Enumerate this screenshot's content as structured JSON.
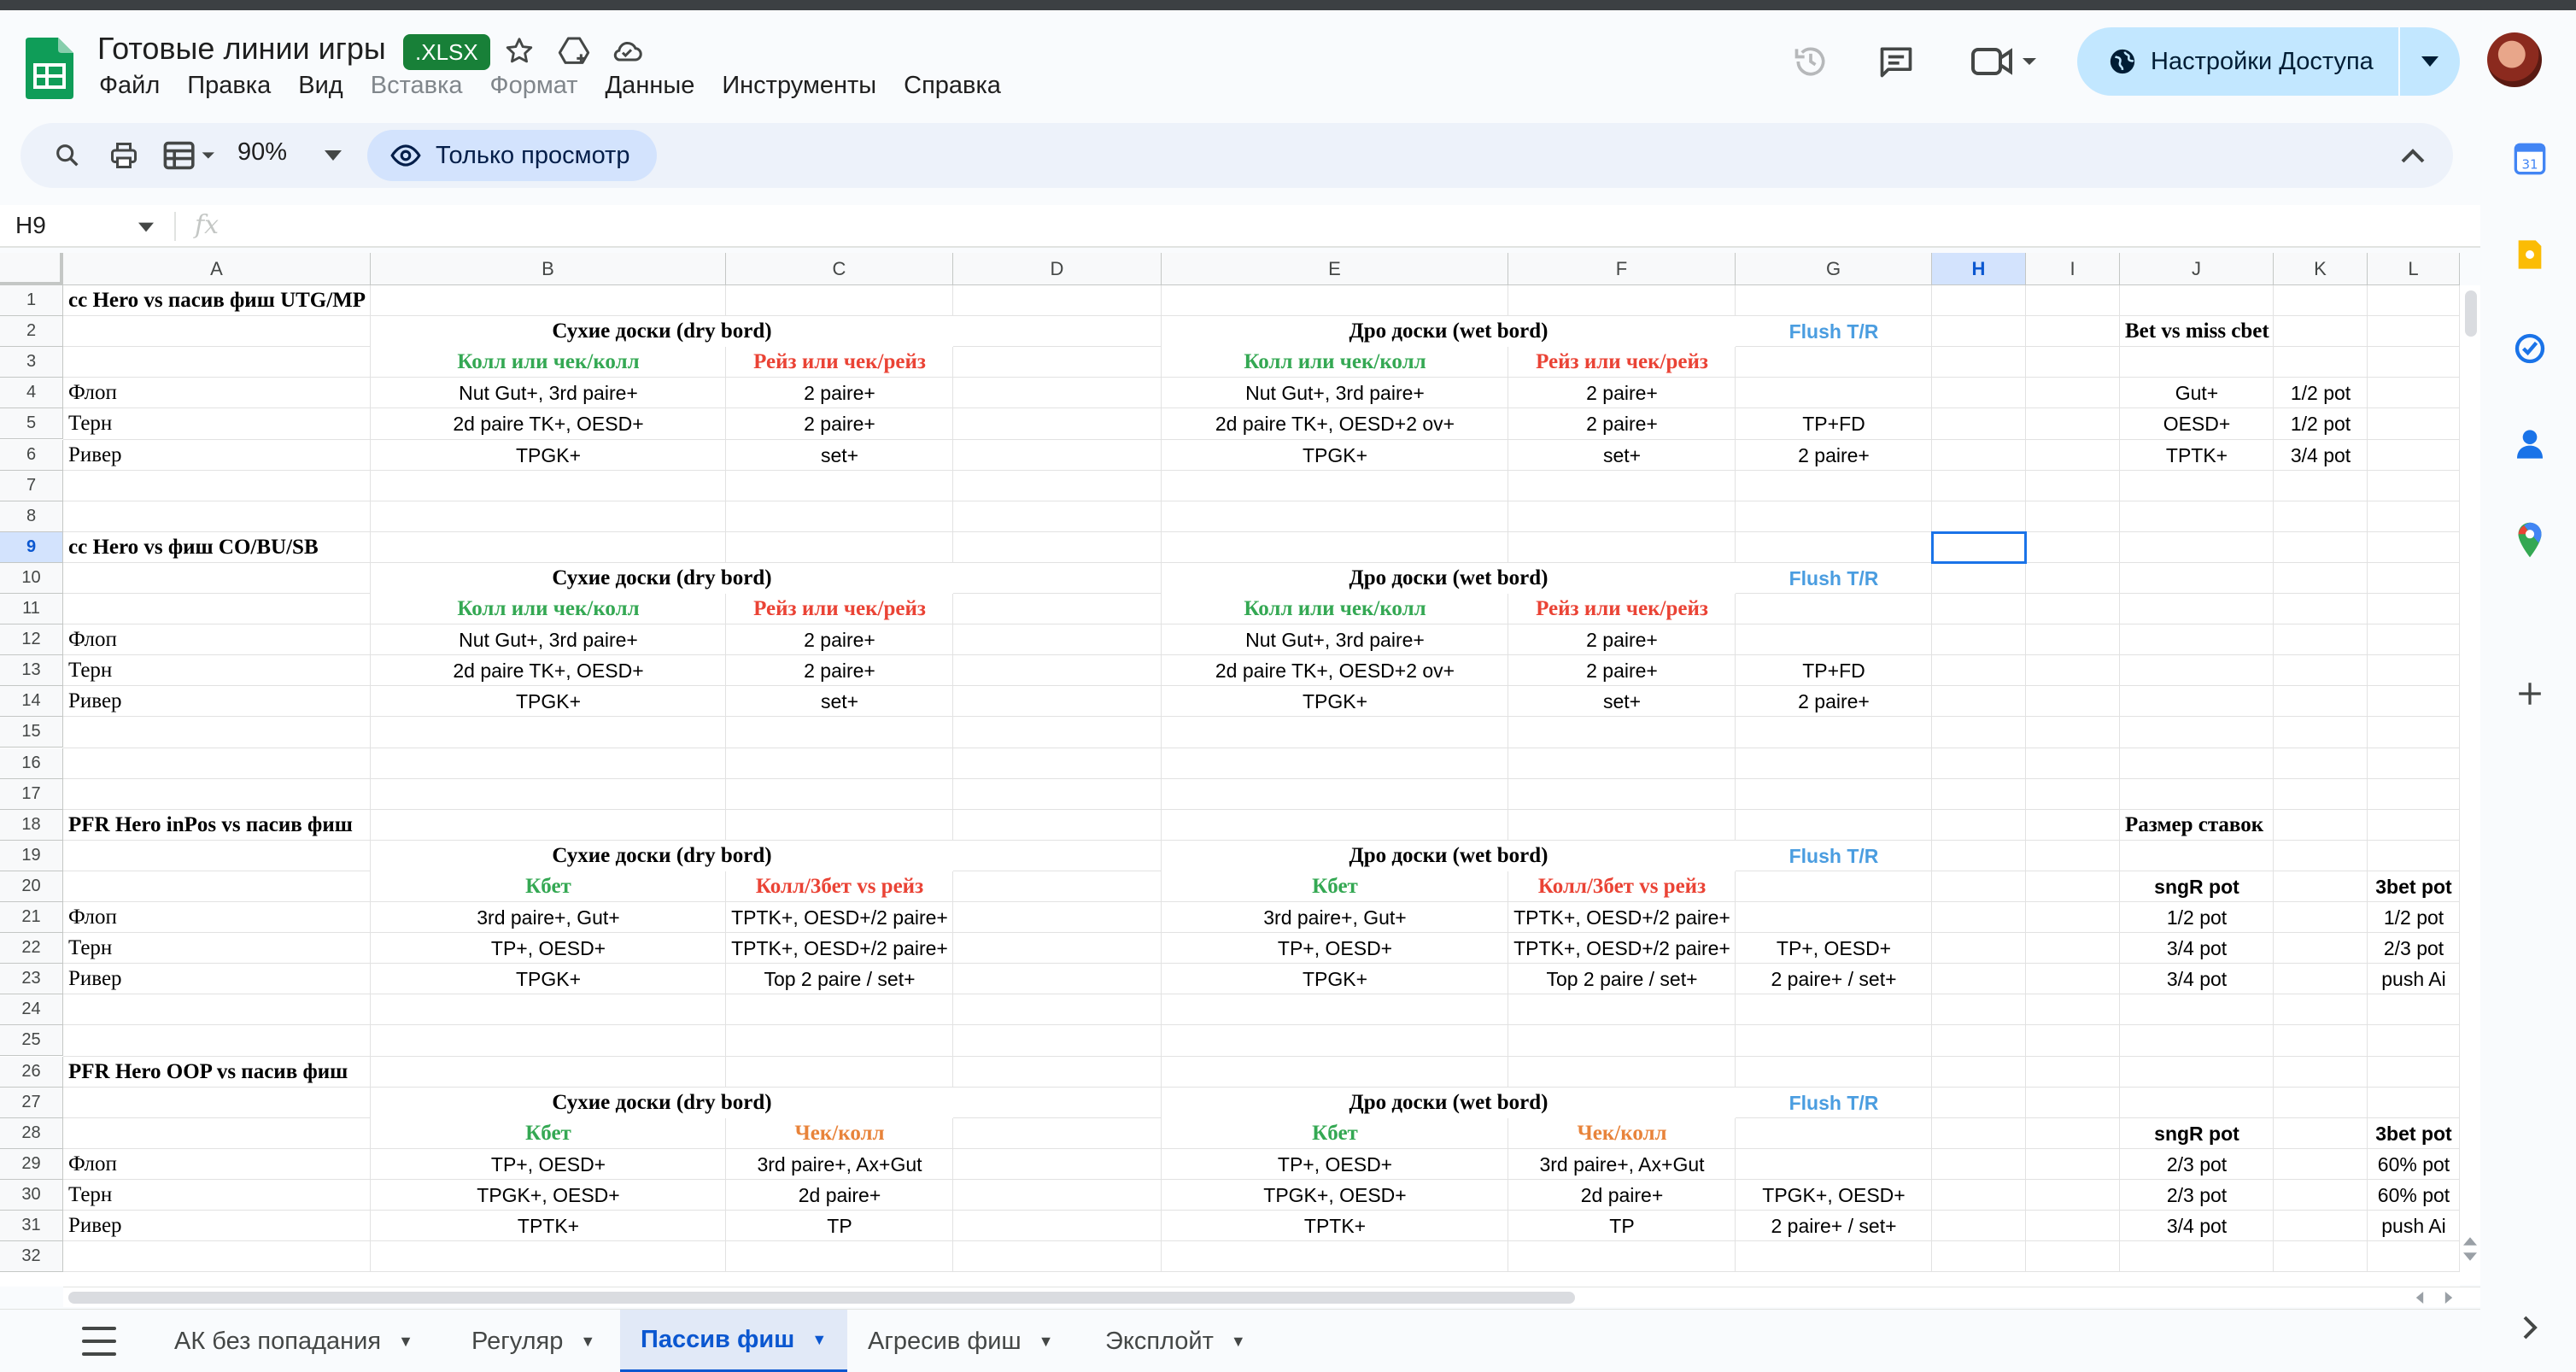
{
  "doc": {
    "title": "Готовые линии игры",
    "badge": ".XLSX"
  },
  "menu": [
    "Файл",
    "Правка",
    "Вид",
    "Вставка",
    "Формат",
    "Данные",
    "Инструменты",
    "Справка"
  ],
  "menu_disabled": [
    false,
    false,
    false,
    true,
    true,
    false,
    false,
    false
  ],
  "share": {
    "label": "Настройки Доступа"
  },
  "toolbar": {
    "zoom": "90%",
    "view_only": "Только просмотр"
  },
  "formula": {
    "namebox": "H9",
    "fx": "fx"
  },
  "columns": [
    "A",
    "B",
    "C",
    "D",
    "E",
    "F",
    "G",
    "H",
    "I",
    "J",
    "K",
    "L"
  ],
  "rows": [
    "1",
    "2",
    "3",
    "4",
    "5",
    "6",
    "7",
    "8",
    "9",
    "10",
    "11",
    "12",
    "13",
    "14",
    "15",
    "16",
    "17",
    "18",
    "19",
    "20",
    "21",
    "22",
    "23",
    "24",
    "25",
    "26",
    "27",
    "28",
    "29",
    "30",
    "31",
    "32"
  ],
  "cells": {
    "r1": {
      "A": "cc Hero vs пасив фиш UTG/MP"
    },
    "r2": {
      "BC": "Сухие доски (dry bord)",
      "EF": "Дро доски (wet bord)",
      "G": "Flush T/R",
      "J": "Bet vs miss cbet"
    },
    "r3": {
      "B": "Колл или чек/колл",
      "C": "Рейз или чек/рейз",
      "E": "Колл или чек/колл",
      "F": "Рейз или чек/рейз"
    },
    "r4": {
      "A": "Флоп",
      "B": "Nut Gut+, 3rd paire+",
      "C": "2 paire+",
      "E": "Nut Gut+, 3rd paire+",
      "F": "2 paire+",
      "J": "Gut+",
      "K": "1/2 pot"
    },
    "r5": {
      "A": "Терн",
      "B": "2d paire TK+, OESD+",
      "C": "2 paire+",
      "E": "2d paire TK+, OESD+2 ov+",
      "F": "2 paire+",
      "G": "TP+FD",
      "J": "OESD+",
      "K": "1/2 pot"
    },
    "r6": {
      "A": "Ривер",
      "B": "TPGK+",
      "C": "set+",
      "E": "TPGK+",
      "F": "set+",
      "G": "2 paire+",
      "J": "TPTK+",
      "K": "3/4 pot"
    },
    "r9": {
      "A": "cc Hero vs фиш CO/BU/SB"
    },
    "r10": {
      "BC": "Сухие доски (dry bord)",
      "EF": "Дро доски (wet bord)",
      "G": "Flush T/R"
    },
    "r11": {
      "B": "Колл или чек/колл",
      "C": "Рейз или чек/рейз",
      "E": "Колл или чек/колл",
      "F": "Рейз или чек/рейз"
    },
    "r12": {
      "A": "Флоп",
      "B": "Nut Gut+, 3rd paire+",
      "C": "2 paire+",
      "E": "Nut Gut+, 3rd paire+",
      "F": "2 paire+"
    },
    "r13": {
      "A": "Терн",
      "B": "2d paire TK+, OESD+",
      "C": "2 paire+",
      "E": "2d paire TK+, OESD+2 ov+",
      "F": "2 paire+",
      "G": "TP+FD"
    },
    "r14": {
      "A": "Ривер",
      "B": "TPGK+",
      "C": "set+",
      "E": "TPGK+",
      "F": "set+",
      "G": "2 paire+"
    },
    "r18": {
      "A": "PFR Hero inPos vs пасив фиш",
      "J": "Размер ставок"
    },
    "r19": {
      "BC": "Сухие доски (dry bord)",
      "EF": "Дро доски (wet bord)",
      "G": "Flush T/R"
    },
    "r20": {
      "B": "Кбет",
      "C": "Колл/3бет vs рейз",
      "E": "Кбет",
      "F": "Колл/3бет vs рейз",
      "J": "sngR pot",
      "L": "3bet pot"
    },
    "r21": {
      "A": "Флоп",
      "B": "3rd paire+, Gut+",
      "C": "TPTK+, OESD+/2 paire+",
      "E": "3rd paire+, Gut+",
      "F": "TPTK+, OESD+/2 paire+",
      "J": "1/2 pot",
      "L": "1/2 pot"
    },
    "r22": {
      "A": "Терн",
      "B": "TP+, OESD+",
      "C": "TPTK+, OESD+/2 paire+",
      "E": "TP+, OESD+",
      "F": "TPTK+, OESD+/2 paire+",
      "G": "TP+, OESD+",
      "J": "3/4 pot",
      "L": "2/3 pot"
    },
    "r23": {
      "A": "Ривер",
      "B": "TPGK+",
      "C": "Top 2 paire / set+",
      "E": "TPGK+",
      "F": "Top 2 paire / set+",
      "G": "2 paire+ / set+",
      "J": "3/4 pot",
      "L": "push Ai"
    },
    "r26": {
      "A": "PFR Hero OOP vs пасив фиш"
    },
    "r27": {
      "BC": "Сухие доски (dry bord)",
      "EF": "Дро доски (wet bord)",
      "G": "Flush T/R"
    },
    "r28": {
      "B": "Кбет",
      "C": "Чек/колл",
      "E": "Кбет",
      "F": "Чек/колл",
      "J": "sngR pot",
      "L": "3bet pot"
    },
    "r29": {
      "A": "Флоп",
      "B": "TP+, OESD+",
      "C": "3rd paire+, Ax+Gut",
      "E": "TP+, OESD+",
      "F": "3rd paire+, Ax+Gut",
      "J": "2/3 pot",
      "L": "60% pot"
    },
    "r30": {
      "A": "Терн",
      "B": "TPGK+, OESD+",
      "C": "2d paire+",
      "E": "TPGK+, OESD+",
      "F": "2d paire+",
      "G": "TPGK+, OESD+",
      "J": "2/3 pot",
      "L": "60% pot"
    },
    "r31": {
      "A": "Ривер",
      "B": "TPTK+",
      "C": "TP",
      "E": "TPTK+",
      "F": "TP",
      "G": "2 paire+ / set+",
      "J": "3/4 pot",
      "L": "push Ai"
    }
  },
  "selected_cell": "H9",
  "sheet_tabs": [
    "АК без попадания",
    "Регуляр",
    "Пассив фиш",
    "Агресив фиш",
    "Эксплойт"
  ],
  "active_tab": "Пассив фиш",
  "colors": {
    "green": "#34a853",
    "red": "#ea4335",
    "blue": "#4a9de0",
    "orange": "#e8833a",
    "accent": "#0b57d0"
  }
}
